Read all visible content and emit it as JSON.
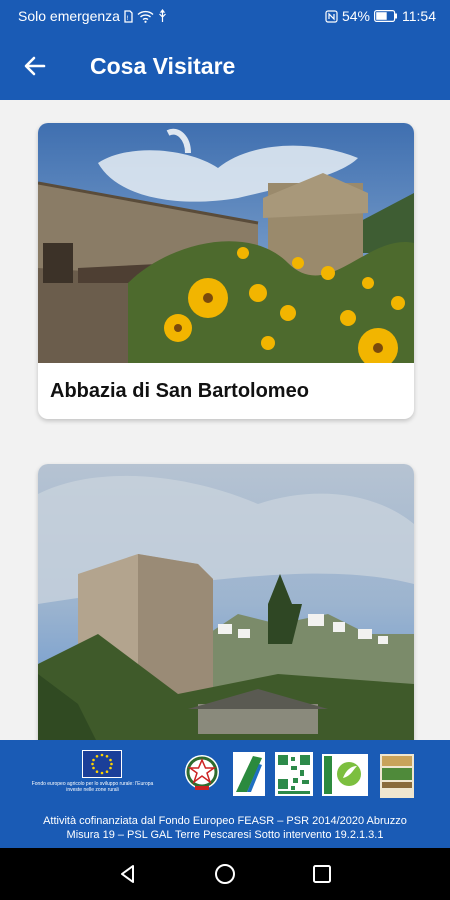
{
  "status_bar": {
    "carrier": "Solo emergenza",
    "battery_percent": "54%",
    "time": "11:54",
    "icons": [
      "sim-icon",
      "wifi-icon",
      "usb-icon",
      "nfc-icon",
      "battery-icon"
    ]
  },
  "app_bar": {
    "title": "Cosa Visitare",
    "back_icon": "arrow-back-icon"
  },
  "places": [
    {
      "title": "Abbazia di San Bartolomeo",
      "image": "abbey-with-yellow-flowers"
    },
    {
      "title": "",
      "image": "stone-tower-and-village"
    }
  ],
  "footer": {
    "eu_caption": "Fondo europeo agricolo per lo sviluppo rurale: l'Europa investe nelle zone rurali",
    "logos": [
      "eu-flag-logo",
      "italian-republic-emblem-logo",
      "abruzzo-region-logo",
      "qr-code-logo",
      "leader-logo",
      "gal-terre-pescaresi-logo"
    ],
    "line1": "Attività cofinanziata dal Fondo Europeo FEASR – PSR 2014/2020 Abruzzo",
    "line2": "Misura 19 – PSL GAL Terre Pescaresi Sotto intervento 19.2.1.3.1"
  },
  "nav_bar": {
    "buttons": [
      "back-triangle-icon",
      "home-circle-icon",
      "recents-square-icon"
    ]
  },
  "colors": {
    "primary": "#1a5bb5",
    "nav_background": "#000000",
    "card_background": "#ffffff"
  }
}
